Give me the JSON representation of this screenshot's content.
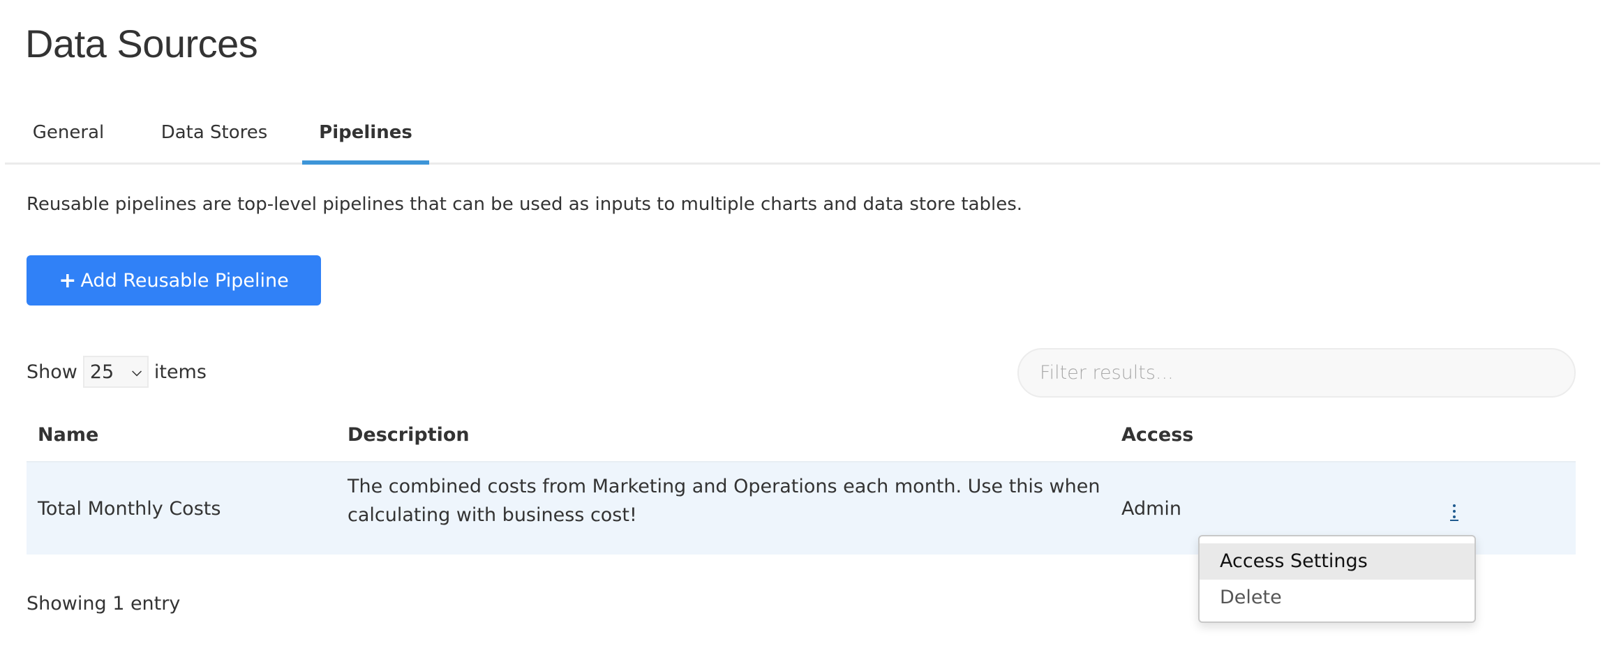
{
  "page": {
    "title": "Data Sources"
  },
  "tabs": [
    {
      "label": "General",
      "active": false
    },
    {
      "label": "Data Stores",
      "active": false
    },
    {
      "label": "Pipelines",
      "active": true
    }
  ],
  "intro_text": "Reusable pipelines are top-level pipelines that can be used as inputs to multiple charts and data store tables.",
  "add_button": {
    "icon": "plus-icon",
    "icon_glyph": "+",
    "label": "Add Reusable Pipeline"
  },
  "pagination": {
    "show_label": "Show",
    "page_size": "25",
    "items_label": "items",
    "chevron_glyph": "⌄"
  },
  "filter": {
    "placeholder": "Filter results...",
    "value": ""
  },
  "table": {
    "columns": [
      "Name",
      "Description",
      "Access"
    ],
    "rows": [
      {
        "name": "Total Monthly Costs",
        "description": "The combined costs from Marketing and Operations each month. Use this when calculating with business cost!",
        "access": "Admin",
        "actions_icon": "kebab-menu-icon"
      }
    ]
  },
  "row_menu": {
    "items": [
      {
        "label": "Access Settings",
        "highlighted": true
      },
      {
        "label": "Delete",
        "highlighted": false
      }
    ]
  },
  "footer": {
    "entry_count_text": "Showing 1 entry"
  },
  "colors": {
    "primary_button": "#3081f7",
    "tab_accent": "#3d95d8",
    "row_highlight": "#eef5fc",
    "link": "#1f5a8f"
  }
}
